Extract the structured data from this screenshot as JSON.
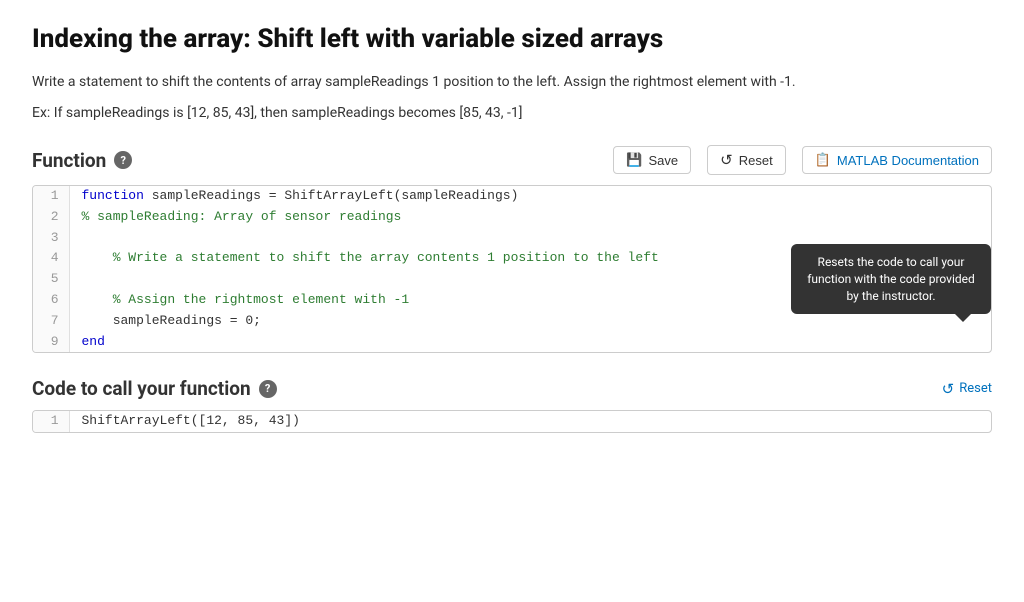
{
  "page": {
    "title": "Indexing the array: Shift left with variable sized arrays",
    "description": "Write a statement to shift the contents of array sampleReadings 1 position to the left.  Assign the rightmost element with -1.",
    "example": "Ex: If sampleReadings is [12, 85, 43], then sampleReadings becomes [85, 43, -1]"
  },
  "function_section": {
    "title": "Function",
    "help_label": "?",
    "save_label": "Save",
    "reset_label": "Reset",
    "matlab_label": "MATLAB Documentation"
  },
  "code_lines": [
    {
      "num": 1,
      "type": "function-def",
      "content": "function sampleReadings = ShiftArrayLeft(sampleReadings)"
    },
    {
      "num": 2,
      "type": "comment",
      "content": "% sampleReading: Array of sensor readings"
    },
    {
      "num": 3,
      "type": "empty",
      "content": ""
    },
    {
      "num": 4,
      "type": "comment",
      "content": "    % Write a statement to shift the array contents 1 position to the left"
    },
    {
      "num": 5,
      "type": "empty",
      "content": ""
    },
    {
      "num": 6,
      "type": "comment",
      "content": "    % Assign the rightmost element with -1"
    },
    {
      "num": 7,
      "type": "code",
      "content": "    sampleReadings = 0;"
    },
    {
      "num": 9,
      "type": "end",
      "content": "end"
    }
  ],
  "tooltip": {
    "text": "Resets the code to call your function with the code provided by the instructor."
  },
  "call_section": {
    "title": "Code to call your function",
    "help_label": "?",
    "reset_label": "Reset"
  },
  "call_lines": [
    {
      "num": 1,
      "content": "ShiftArrayLeft([12, 85, 43])"
    }
  ],
  "icons": {
    "save": "💾",
    "reset": "↺",
    "matlab": "📋"
  }
}
